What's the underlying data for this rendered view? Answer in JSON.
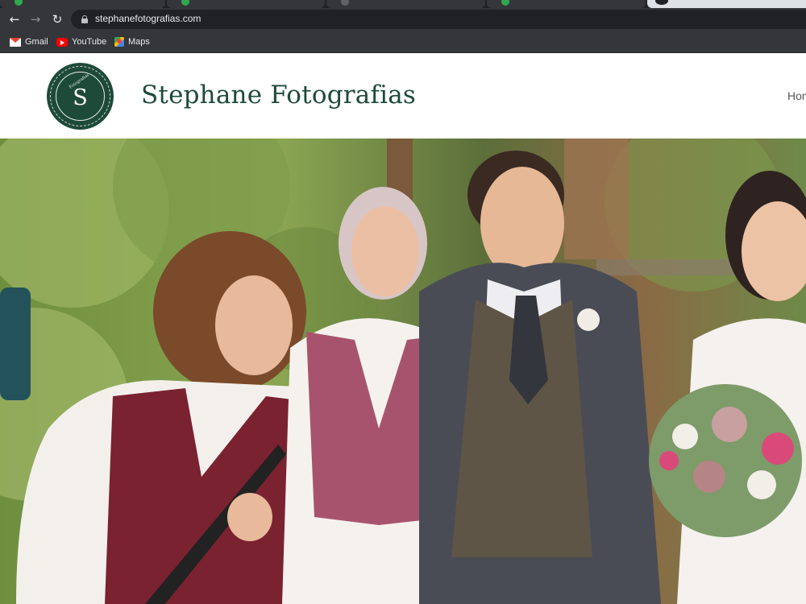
{
  "browser": {
    "url": "stephanefotografias.com",
    "bookmarks": [
      {
        "label": "Gmail",
        "icon": "gmail-icon"
      },
      {
        "label": "YouTube",
        "icon": "youtube-icon"
      },
      {
        "label": "Maps",
        "icon": "maps-icon"
      }
    ]
  },
  "site": {
    "title": "Stephane Fotografias",
    "logo_letter": "S",
    "logo_arc_text": "Fotografias",
    "nav": {
      "home": "Hom"
    }
  },
  "hero": {
    "description_icon": "wedding-photo"
  },
  "colors": {
    "brand_green": "#1e4a3a",
    "chrome_dark": "#35363a"
  }
}
